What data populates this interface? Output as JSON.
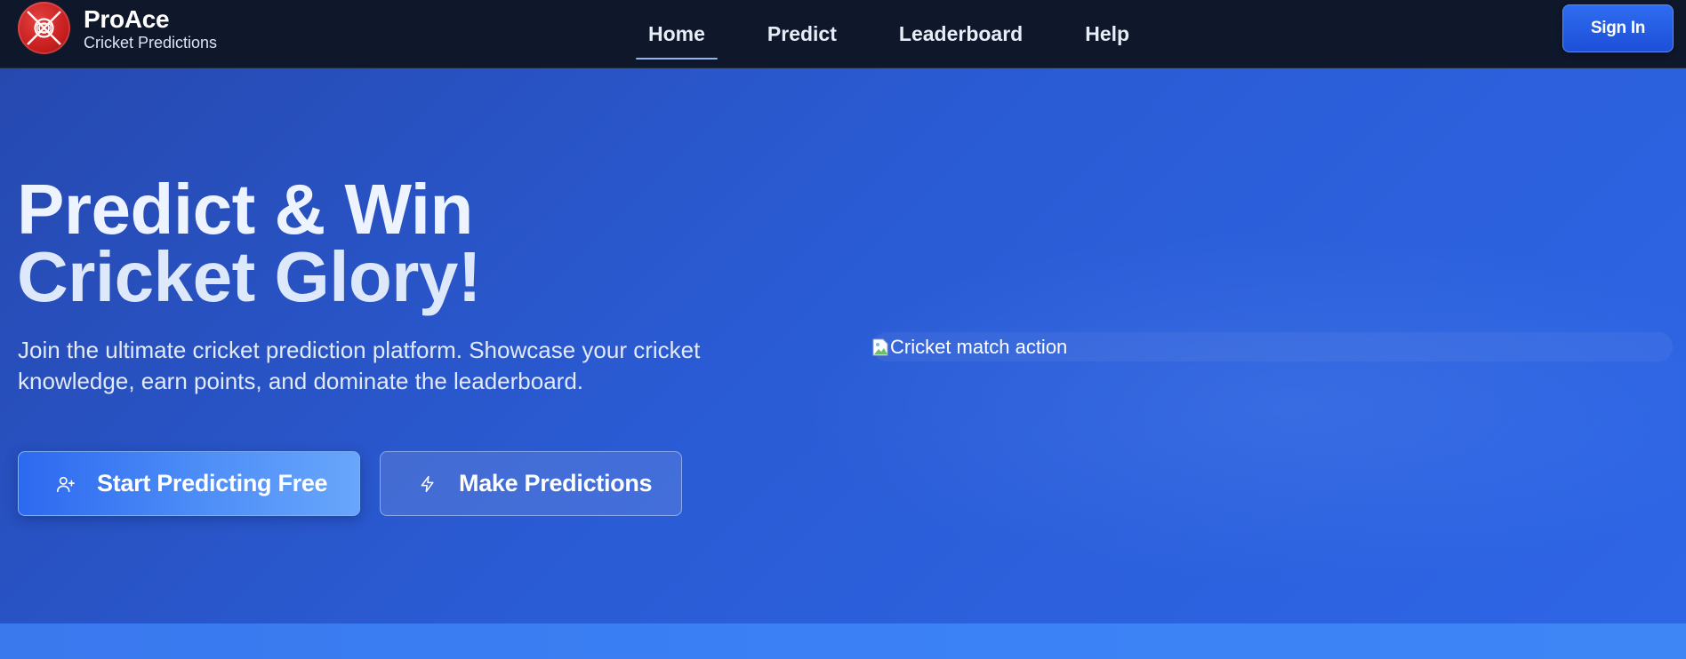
{
  "brand": {
    "name": "ProAce",
    "subtitle": "Cricket Predictions",
    "logo_icon": "cricket-ball-icon"
  },
  "nav": {
    "items": [
      {
        "label": "Home",
        "active": true
      },
      {
        "label": "Predict",
        "active": false
      },
      {
        "label": "Leaderboard",
        "active": false
      },
      {
        "label": "Help",
        "active": false
      }
    ],
    "sign_in_label": "Sign In"
  },
  "hero": {
    "title_line1": "Predict & Win",
    "title_line2": "Cricket Glory!",
    "description": "Join the ultimate cricket prediction platform. Showcase your cricket knowledge, earn points, and dominate the leaderboard.",
    "primary_button": {
      "label": "Start Predicting Free",
      "icon": "user-plus-icon"
    },
    "secondary_button": {
      "label": "Make Predictions",
      "icon": "lightning-icon"
    },
    "image_alt": "Cricket match action"
  },
  "colors": {
    "navbar_bg": "#0f172a",
    "hero_bg": "#2a5bd4",
    "accent": "#2f6cf0",
    "logo_red": "#c81e1e"
  }
}
